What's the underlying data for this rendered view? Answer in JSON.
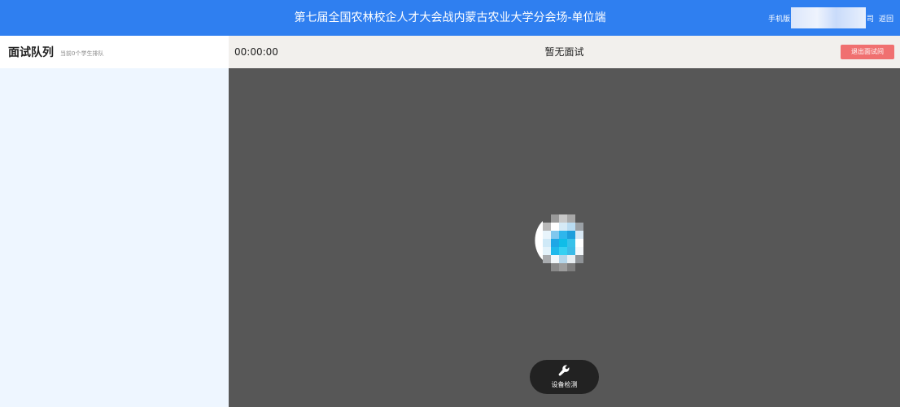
{
  "header": {
    "title": "第七届全国农林校企人才大会战内蒙古农业大学分会场-单位端",
    "mobile_label": "手机版",
    "company_suffix": "司",
    "back_label": "返回"
  },
  "sidebar": {
    "heading": "面试队列",
    "queue_status": "当前0个学生排队"
  },
  "interview": {
    "timer": "00:00:00",
    "status": "暂无面试",
    "exit_label": "退出面试间"
  },
  "controls": {
    "device_check_label": "设备检测",
    "device_check_icon": "wrench-icon"
  },
  "colors": {
    "header_bg": "#2f7ff0",
    "sidebar_bg": "#eef6ff",
    "toolbar_bg": "#f2f0ed",
    "video_bg": "#575757",
    "exit_button": "#f07070"
  }
}
